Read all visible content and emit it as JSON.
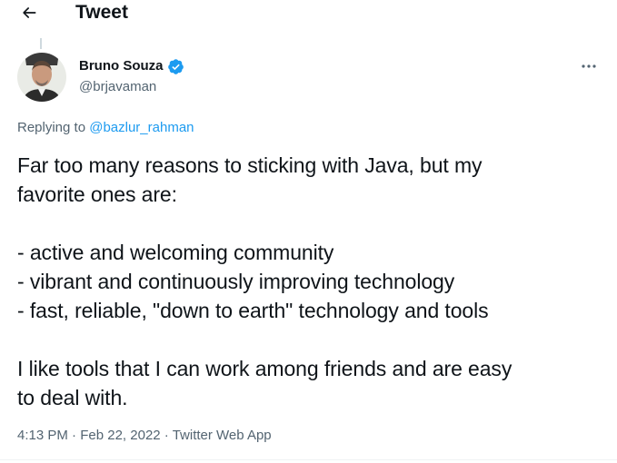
{
  "header": {
    "back_icon": "arrow-left-icon",
    "title": "Tweet"
  },
  "tweet": {
    "author": {
      "display_name": "Bruno Souza",
      "handle": "@brjavaman",
      "verified": true,
      "verified_color": "#1d9bf0",
      "avatar_icon": "user-avatar"
    },
    "more_icon": "more-horizontal-icon",
    "reply_prefix": "Replying to",
    "reply_handle": "@bazlur_rahman",
    "text_lines": [
      "Far too many reasons to sticking with Java, but my",
      "favorite ones are:",
      "",
      "- active and welcoming community",
      "- vibrant and continuously improving technology",
      "- fast, reliable, \"down to earth\" technology and tools",
      "",
      "I like tools that I can work among friends and are easy",
      "to deal with."
    ],
    "time": "4:13 PM",
    "date": "Feb 22, 2022",
    "source": "Twitter Web App",
    "separator": "·"
  },
  "colors": {
    "text": "#0f1419",
    "secondary": "#536471",
    "link": "#1d9bf0"
  }
}
